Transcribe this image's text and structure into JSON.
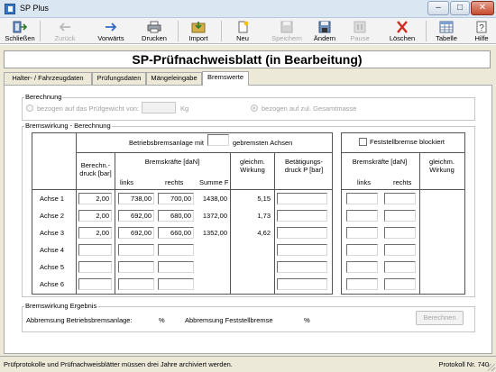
{
  "window": {
    "title": "SP Plus",
    "minimize": "–",
    "maximize": "□",
    "close": "✕"
  },
  "toolbar": [
    {
      "name": "schliessen",
      "label": "Schließen",
      "icon": "exit-icon",
      "enabled": true
    },
    {
      "name": "zurueck",
      "label": "Zurück",
      "icon": "arrow-left-icon",
      "enabled": false
    },
    {
      "name": "vorwaerts",
      "label": "Vorwärts",
      "icon": "arrow-right-icon",
      "enabled": true
    },
    {
      "name": "drucken",
      "label": "Drucken",
      "icon": "printer-icon",
      "enabled": true
    },
    {
      "name": "import",
      "label": "Import",
      "icon": "import-icon",
      "enabled": true
    },
    {
      "name": "neu",
      "label": "Neu",
      "icon": "new-document-icon",
      "enabled": true
    },
    {
      "name": "speichern",
      "label": "Speichern",
      "icon": "save-icon",
      "enabled": false
    },
    {
      "name": "aendern",
      "label": "Ändern",
      "icon": "edit-icon",
      "enabled": true
    },
    {
      "name": "pause",
      "label": "Pause",
      "icon": "pause-icon",
      "enabled": false
    },
    {
      "name": "loeschen",
      "label": "Löschen",
      "icon": "delete-icon",
      "enabled": true
    },
    {
      "name": "tabelle",
      "label": "Tabelle",
      "icon": "table-icon",
      "enabled": true
    },
    {
      "name": "hilfe",
      "label": "Hilfe",
      "icon": "help-icon",
      "enabled": true
    }
  ],
  "page_title": "SP-Prüfnachweisblatt (in Bearbeitung)",
  "tabs": [
    {
      "label": "Halter- / Fahrzeugdaten",
      "active": false
    },
    {
      "label": "Prüfungsdaten",
      "active": false
    },
    {
      "label": "Mängeleingabe",
      "active": false
    },
    {
      "label": "Bremswerte",
      "active": true
    }
  ],
  "berechnung": {
    "legend": "Berechnung",
    "option1": "bezogen auf das Prüfgewicht von:",
    "weight_value": "",
    "unit": "Kg",
    "option2": "bezogen auf zul. Gesamtmasse",
    "selected": "option2"
  },
  "bremswirkung": {
    "legend": "Bremswirkung - Berechnung",
    "betriebs_label": "Betriebsbremsanlage mit",
    "achsen_value": "",
    "achsen_label": "gebremsten Achsen",
    "headers": {
      "druck": "Berechn.- druck [bar]",
      "bremskraefte": "Bremskräfte [daN]",
      "links": "links",
      "rechts": "rechts",
      "summe": "Summe F",
      "gleichm": "gleichm. Wirkung",
      "betaetigung": "Betätigungs- druck P [bar]"
    },
    "rows": [
      {
        "label": "Achse 1",
        "druck": "2,00",
        "links": "738,00",
        "rechts": "700,00",
        "summe": "1438,00",
        "gleichm": "5,15",
        "p": ""
      },
      {
        "label": "Achse 2",
        "druck": "2,00",
        "links": "692,00",
        "rechts": "680,00",
        "summe": "1372,00",
        "gleichm": "1,73",
        "p": ""
      },
      {
        "label": "Achse 3",
        "druck": "2,00",
        "links": "692,00",
        "rechts": "660,00",
        "summe": "1352,00",
        "gleichm": "4,62",
        "p": ""
      },
      {
        "label": "Achse 4",
        "druck": "",
        "links": "",
        "rechts": "",
        "summe": "",
        "gleichm": "",
        "p": ""
      },
      {
        "label": "Achse 5",
        "druck": "",
        "links": "",
        "rechts": "",
        "summe": "",
        "gleichm": "",
        "p": ""
      },
      {
        "label": "Achse 6",
        "druck": "",
        "links": "",
        "rechts": "",
        "summe": "",
        "gleichm": "",
        "p": ""
      }
    ],
    "feststell": {
      "checkbox_label": "Feststellbremse blockiert",
      "checked": false,
      "bremskraefte": "Bremskräfte [daN]",
      "links": "links",
      "rechts": "rechts",
      "gleichm": "gleichm. Wirkung"
    }
  },
  "ergebnis": {
    "legend": "Bremswirkung Ergebnis",
    "betriebs_label": "Abbremsung Betriebsbremsanlage:",
    "betriebs_unit": "%",
    "feststell_label": "Abbremsung Feststellbremse",
    "feststell_unit": "%",
    "button": "Berechnen"
  },
  "status": {
    "left": "Prüfprotokolle und Prüfnachweisblätter müssen drei Jahre archiviert werden.",
    "right": "Protokoll Nr. 740"
  }
}
